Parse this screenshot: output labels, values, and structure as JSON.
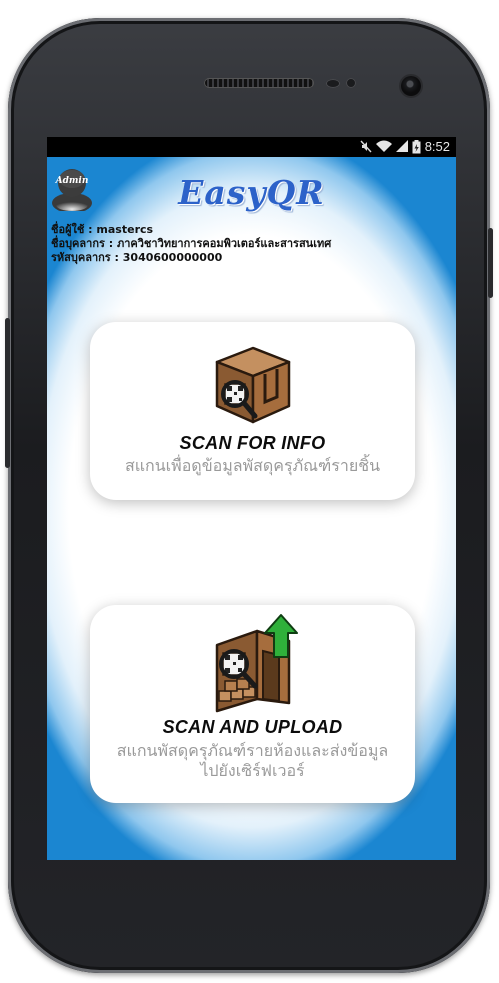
{
  "status_bar": {
    "time": "8:52"
  },
  "header": {
    "avatar_label": "Admin",
    "app_title": "EasyQR"
  },
  "user_info": {
    "username_line": "ชื่อผู้ใช้ : mastercs",
    "department_line": "ชื่อบุคลากร : ภาควิชาวิทยาการคอมพิวเตอร์และสารสนเทศ",
    "staff_id_line": "รหัสบุคลากร : 3040600000000"
  },
  "cards": [
    {
      "title": "SCAN FOR INFO",
      "subtitle": "สแกนเพื่อดูข้อมูลพัสดุครุภัณฑ์รายชิ้น",
      "icon": "box-qr-magnifier-icon"
    },
    {
      "title": "SCAN AND UPLOAD",
      "subtitle": "สแกนพัสดุครุภัณฑ์รายห้องและส่งข้อมูลไปยังเซิร์ฟเวอร์",
      "icon": "room-qr-upload-icon"
    }
  ],
  "colors": {
    "title_blue": "#2c62c9",
    "edge_blue": "#1b86d1"
  }
}
